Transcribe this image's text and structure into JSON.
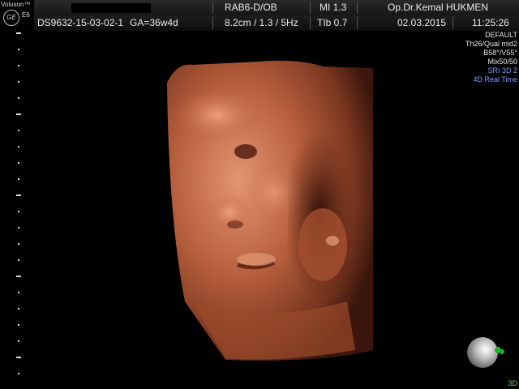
{
  "branding": {
    "brand": "Voluson™",
    "model": "E6",
    "logo_text": "GE"
  },
  "header": {
    "row1": {
      "probe": "RAB6-D/OB",
      "mi": "MI  1.3",
      "doctor": "Op.Dr.Kemal HUKMEN"
    },
    "row2": {
      "patient_id": "DS9632-15-03-02-1",
      "ga": "GA=36w4d",
      "settings": "8.2cm / 1.3 / 5Hz",
      "tib": "TIb  0.7",
      "date": "02.03.2015",
      "time": "11:25:26"
    }
  },
  "right_panel": {
    "lines": [
      "DEFAULT",
      "Th26/Qual mid2",
      "B58°/V55°",
      "Mix50/50"
    ],
    "mode_lines": [
      "SRI 3D 2",
      "4D Real Time"
    ]
  },
  "footer": {
    "mode_tag": "3D"
  },
  "colors": {
    "flesh": "#b45a3a",
    "mode_blue": "#7f9bff",
    "status_green": "#1fb22b"
  }
}
